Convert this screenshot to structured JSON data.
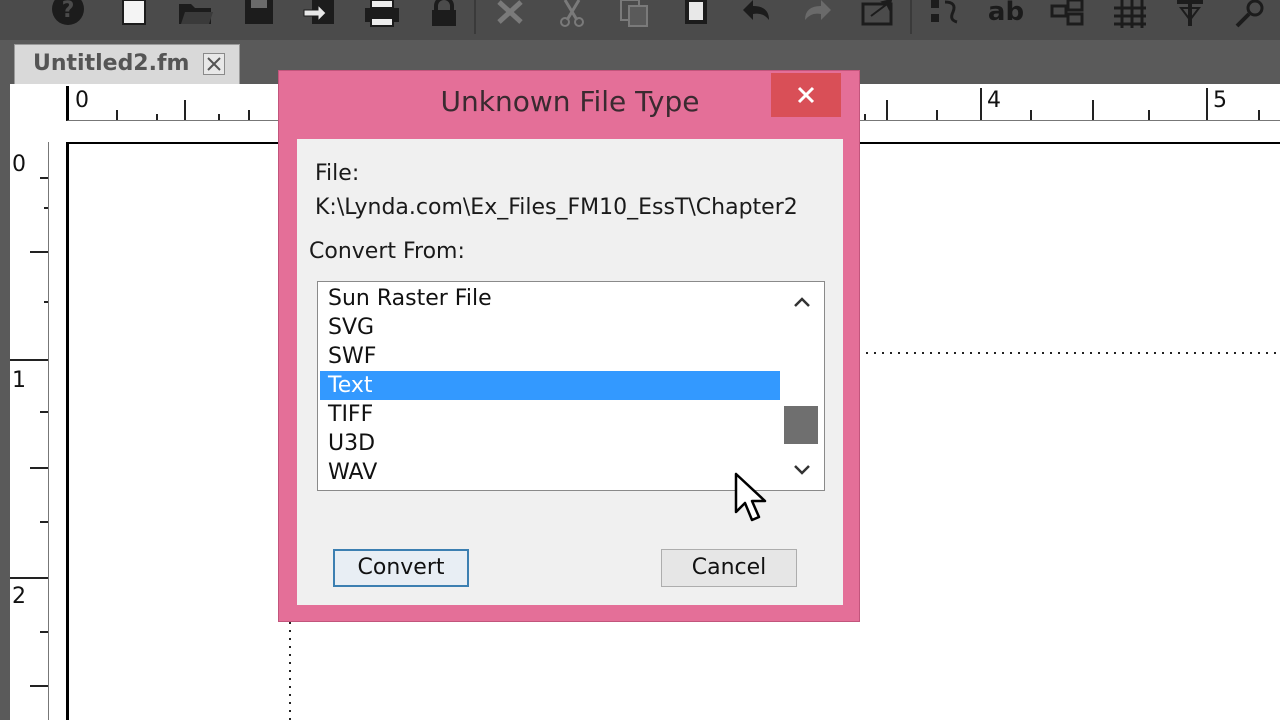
{
  "window": {
    "doc_tab": {
      "title": "Untitled2.fm"
    }
  },
  "toolbar": {
    "find_replace_glyph": "ab"
  },
  "rulers": {
    "horizontal": [
      "0",
      "4",
      "5"
    ],
    "vertical": [
      "0",
      "1",
      "2"
    ]
  },
  "dialog": {
    "title": "Unknown File Type",
    "file_label": "File:",
    "file_path": "K:\\Lynda.com\\Ex_Files_FM10_EssT\\Chapter2",
    "convert_from_label": "Convert From:",
    "formats": [
      {
        "label": "Sun Raster File",
        "selected": false
      },
      {
        "label": "SVG",
        "selected": false
      },
      {
        "label": "SWF",
        "selected": false
      },
      {
        "label": "Text",
        "selected": true
      },
      {
        "label": "TIFF",
        "selected": false
      },
      {
        "label": "U3D",
        "selected": false
      },
      {
        "label": "WAV",
        "selected": false
      }
    ],
    "convert_button": "Convert",
    "cancel_button": "Cancel"
  },
  "colors": {
    "dialog_frame": "#e46f98",
    "close_button": "#d94f57",
    "selection": "#3399ff",
    "dialog_body": "#f0f0f0"
  }
}
